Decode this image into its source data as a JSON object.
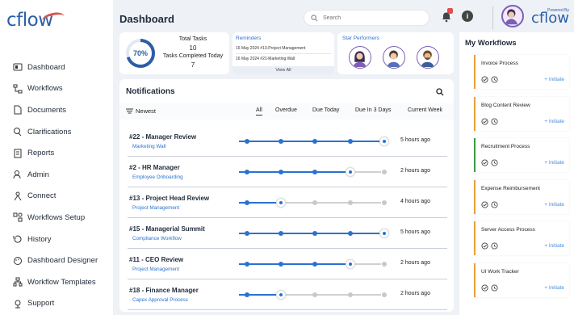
{
  "brand": {
    "name": "cflow",
    "powered_by": "Powered By"
  },
  "header": {
    "title": "Dashboard",
    "search_placeholder": "Search",
    "info_glyph": "i"
  },
  "sidebar": {
    "items": [
      {
        "label": "Dashboard",
        "icon": "dashboard-icon"
      },
      {
        "label": "Workflows",
        "icon": "workflows-icon"
      },
      {
        "label": "Documents",
        "icon": "documents-icon"
      },
      {
        "label": "Clarifications",
        "icon": "clarifications-icon"
      },
      {
        "label": "Reports",
        "icon": "reports-icon"
      },
      {
        "label": "Admin",
        "icon": "admin-icon"
      },
      {
        "label": "Connect",
        "icon": "connect-icon"
      },
      {
        "label": "Workflows Setup",
        "icon": "workflows-setup-icon"
      },
      {
        "label": "History",
        "icon": "history-icon"
      },
      {
        "label": "Dashboard Designer",
        "icon": "dashboard-designer-icon"
      },
      {
        "label": "Workflow Templates",
        "icon": "workflow-templates-icon"
      },
      {
        "label": "Support",
        "icon": "support-icon"
      }
    ]
  },
  "tasks": {
    "percent_label": "70%",
    "percent": 70,
    "total_label": "Total Tasks",
    "total_value": "10",
    "completed_label": "Tasks Completed Today",
    "completed_value": "7"
  },
  "reminders": {
    "title": "Reminders",
    "items": [
      "16 May 2024 #13-Project Management",
      "16 May 2024 #21-Marketing Wall"
    ],
    "view_all": "View All"
  },
  "star_performers": {
    "title": "Star Performers"
  },
  "notifications": {
    "title": "Notifications",
    "sort_label": "Newest",
    "tabs": [
      "All",
      "Overdue",
      "Due Today",
      "Due In 3 Days",
      "Current Week"
    ],
    "active_tab": "All",
    "rows": [
      {
        "title": "#22 - Manager Review",
        "subtitle": "Marketing Wall",
        "time": "5 hours ago",
        "step": 4,
        "steps": 5
      },
      {
        "title": "#2 - HR Manager",
        "subtitle": "Employee Onboarding",
        "time": "2 hours ago",
        "step": 3,
        "steps": 5
      },
      {
        "title": "#13 - Project Head Review",
        "subtitle": "Project Management",
        "time": "4 hours ago",
        "step": 1,
        "steps": 5
      },
      {
        "title": "#15 - Managerial Summit",
        "subtitle": "Compliance Workflow",
        "time": "5 hours ago",
        "step": 4,
        "steps": 5
      },
      {
        "title": "#11 - CEO Review",
        "subtitle": "Project Management",
        "time": "2 hours ago",
        "step": 3,
        "steps": 5
      },
      {
        "title": "#18 - Finance Manager",
        "subtitle": "Capex Approval Process",
        "time": "2 hours ago",
        "step": 1,
        "steps": 5
      }
    ]
  },
  "my_workflows": {
    "title": "My Workflows",
    "initiate_label": "+ Initiate",
    "items": [
      {
        "name": "Invoice Process",
        "accent": "orange"
      },
      {
        "name": "Blog Content Review",
        "accent": "orange"
      },
      {
        "name": "Recruitment Process",
        "accent": "green"
      },
      {
        "name": "Expense Reimbursement",
        "accent": "orange"
      },
      {
        "name": "Server Access Process",
        "accent": "orange"
      },
      {
        "name": "UI Work Tracker",
        "accent": "orange"
      }
    ]
  },
  "colors": {
    "brand": "#2a5fa6",
    "link": "#2a72d0",
    "progress": "#2a72d0",
    "badge": "#e05050",
    "orange": "#e6a13a",
    "green": "#3a9a4a"
  }
}
